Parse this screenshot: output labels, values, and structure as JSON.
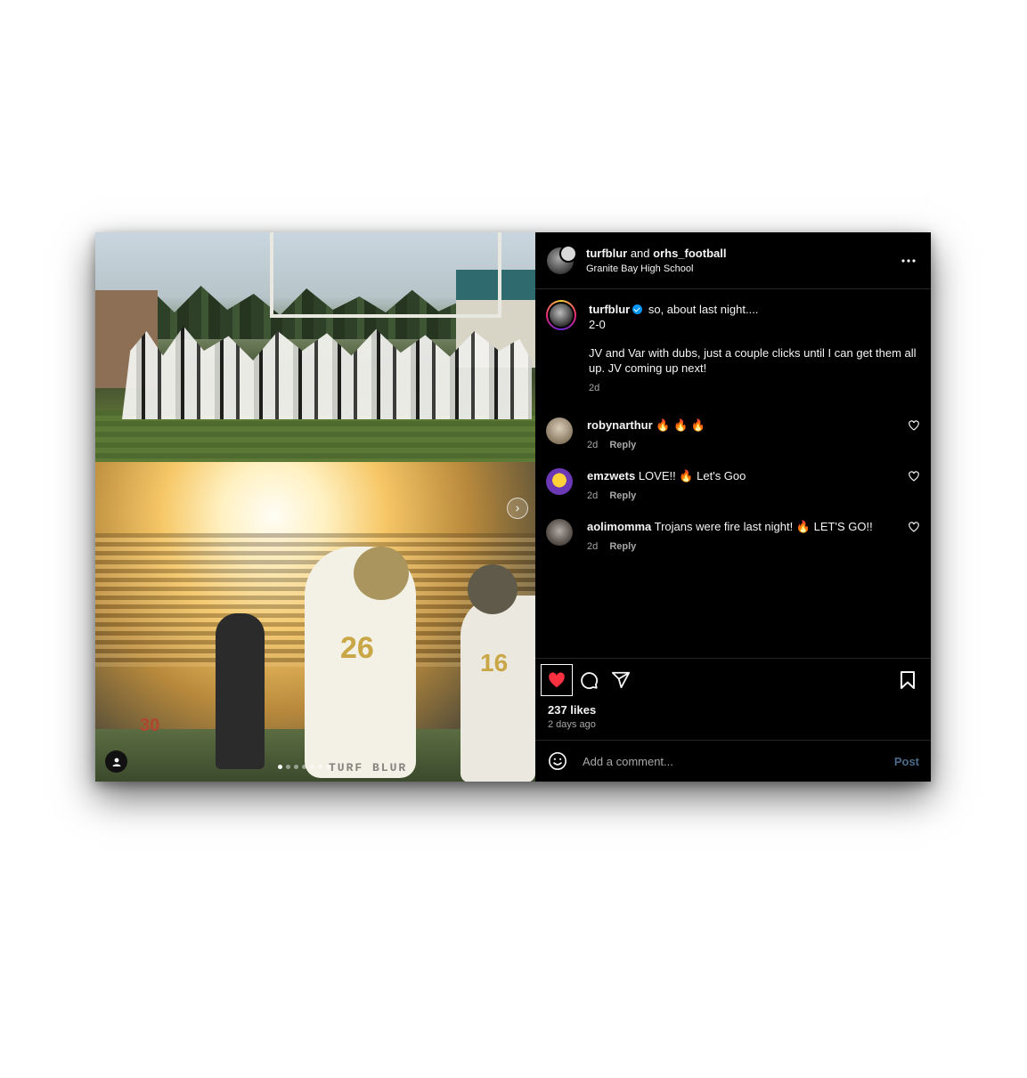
{
  "header": {
    "username": "turfblur",
    "joiner": " and ",
    "collaborator": "orhs_football",
    "location": "Granite Bay High School"
  },
  "caption": {
    "username": "turfblur",
    "line1": "so, about last night....",
    "line2": "2-0",
    "body": "JV and Var with dubs, just a couple clicks until I can get them all up. JV coming up next!",
    "time": "2d"
  },
  "comments": [
    {
      "username": "robynarthur",
      "text": "🔥 🔥 🔥",
      "time": "2d",
      "reply": "Reply"
    },
    {
      "username": "emzwets",
      "text": "LOVE!! 🔥  Let's Goo",
      "time": "2d",
      "reply": "Reply"
    },
    {
      "username": "aolimomma",
      "text": "Trojans were fire last night! 🔥  LET'S GO!!",
      "time": "2d",
      "reply": "Reply"
    }
  ],
  "stats": {
    "likes": "237 likes",
    "date": "2 days ago"
  },
  "composer": {
    "placeholder": "Add a comment...",
    "post_label": "Post"
  },
  "media": {
    "watermark": "TURF BLUR",
    "slide_count": 7,
    "current_slide": 1
  },
  "colors": {
    "like_red": "#ff3040",
    "verified_blue": "#0095f6",
    "panel_bg": "#000000"
  }
}
